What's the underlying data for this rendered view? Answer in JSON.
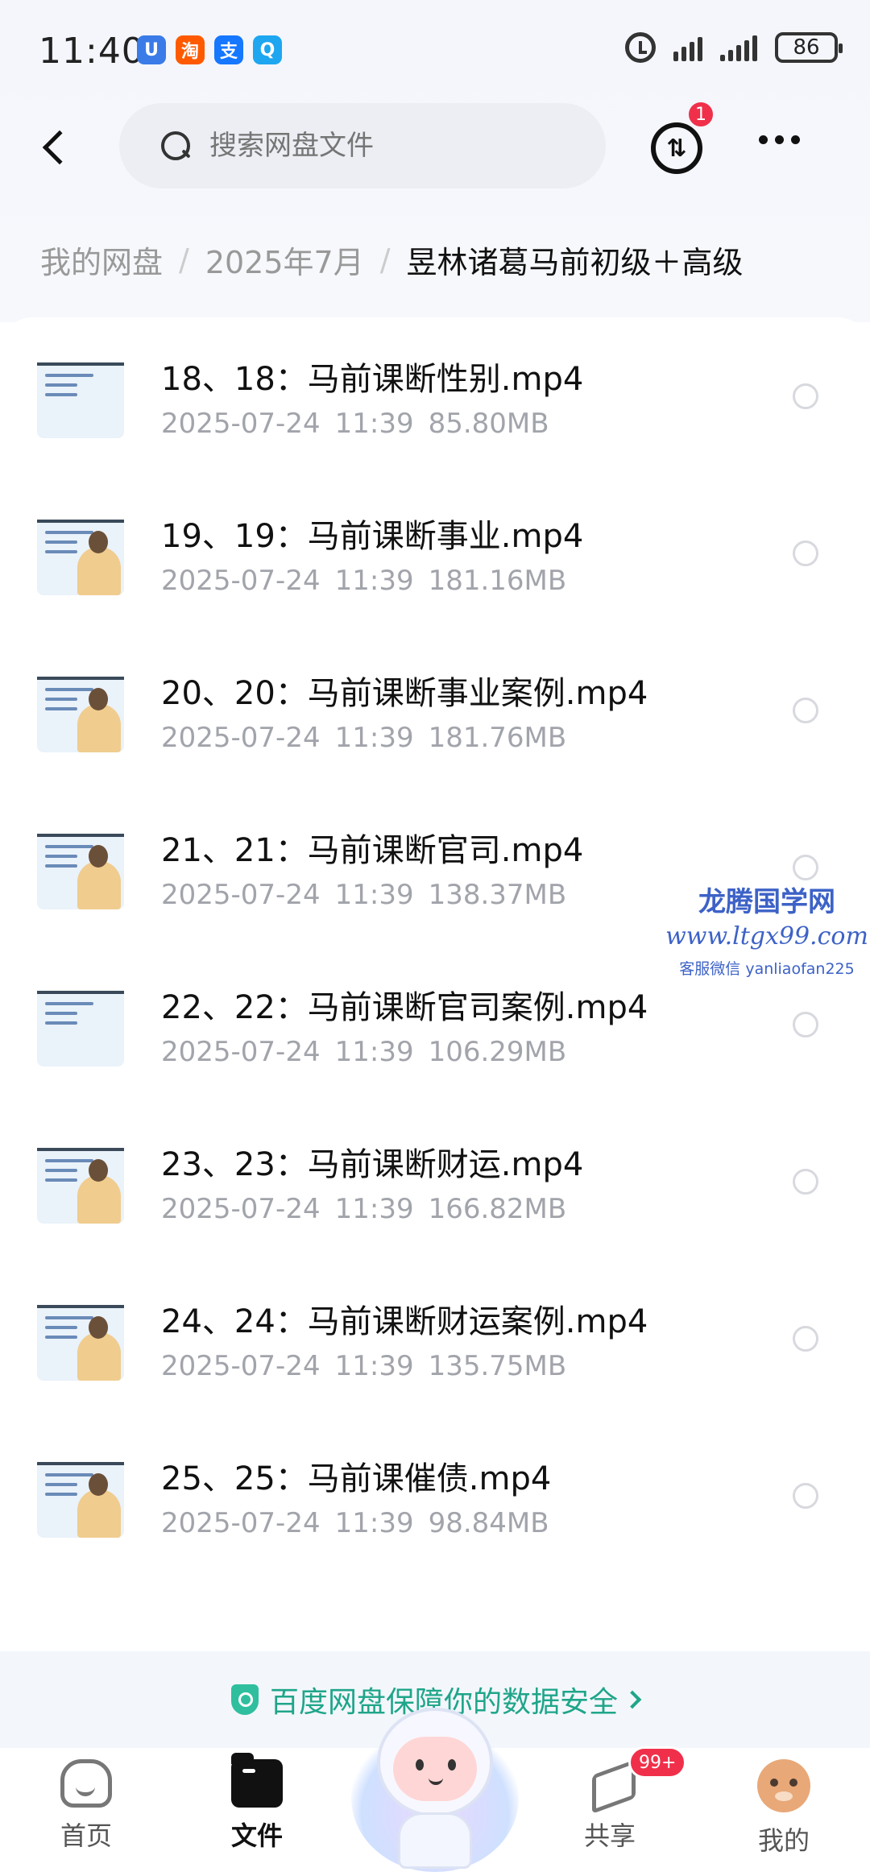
{
  "status_bar": {
    "time": "11:40",
    "notifications": [
      {
        "icon": "notification-app-icon",
        "glyph": "U",
        "color": "#3a7be8"
      },
      {
        "icon": "taobao-icon",
        "glyph": "淘",
        "color": "#ff5a00"
      },
      {
        "icon": "alipay-icon",
        "glyph": "支",
        "color": "#1677ff"
      },
      {
        "icon": "search-app-icon",
        "glyph": "Q",
        "color": "#1ea6f0"
      }
    ],
    "battery": "86"
  },
  "header": {
    "search_placeholder": "搜索网盘文件",
    "transfer_glyph": "⇅",
    "transfer_badge": "1"
  },
  "breadcrumb": {
    "items": [
      "我的网盘",
      "2025年7月"
    ],
    "separator": "/",
    "current": "昱林诸葛马前初级＋高级"
  },
  "files": [
    {
      "name": "18、18：马前课断性别.mp4",
      "date": "2025-07-24",
      "time": "11:39",
      "size": "85.80MB"
    },
    {
      "name": "19、19：马前课断事业.mp4",
      "date": "2025-07-24",
      "time": "11:39",
      "size": "181.16MB"
    },
    {
      "name": "20、20：马前课断事业案例.mp4",
      "date": "2025-07-24",
      "time": "11:39",
      "size": "181.76MB"
    },
    {
      "name": "21、21：马前课断官司.mp4",
      "date": "2025-07-24",
      "time": "11:39",
      "size": "138.37MB"
    },
    {
      "name": "22、22：马前课断官司案例.mp4",
      "date": "2025-07-24",
      "time": "11:39",
      "size": "106.29MB"
    },
    {
      "name": "23、23：马前课断财运.mp4",
      "date": "2025-07-24",
      "time": "11:39",
      "size": "166.82MB"
    },
    {
      "name": "24、24：马前课断财运案例.mp4",
      "date": "2025-07-24",
      "time": "11:39",
      "size": "135.75MB"
    },
    {
      "name": "25、25：马前课催债.mp4",
      "date": "2025-07-24",
      "time": "11:39",
      "size": "98.84MB"
    }
  ],
  "watermark": {
    "title": "龙腾国学网",
    "url": "www.ltgx99.com",
    "contact": "客服微信 yanliaofan225"
  },
  "security_banner": {
    "text": "百度网盘保障你的数据安全"
  },
  "bottom_nav": {
    "home": "首页",
    "files": "文件",
    "share": "共享",
    "share_badge": "99+",
    "me": "我的"
  },
  "colors": {
    "accent": "#1fa58a",
    "badge": "#f0304a",
    "watermark": "#3d62c7"
  }
}
